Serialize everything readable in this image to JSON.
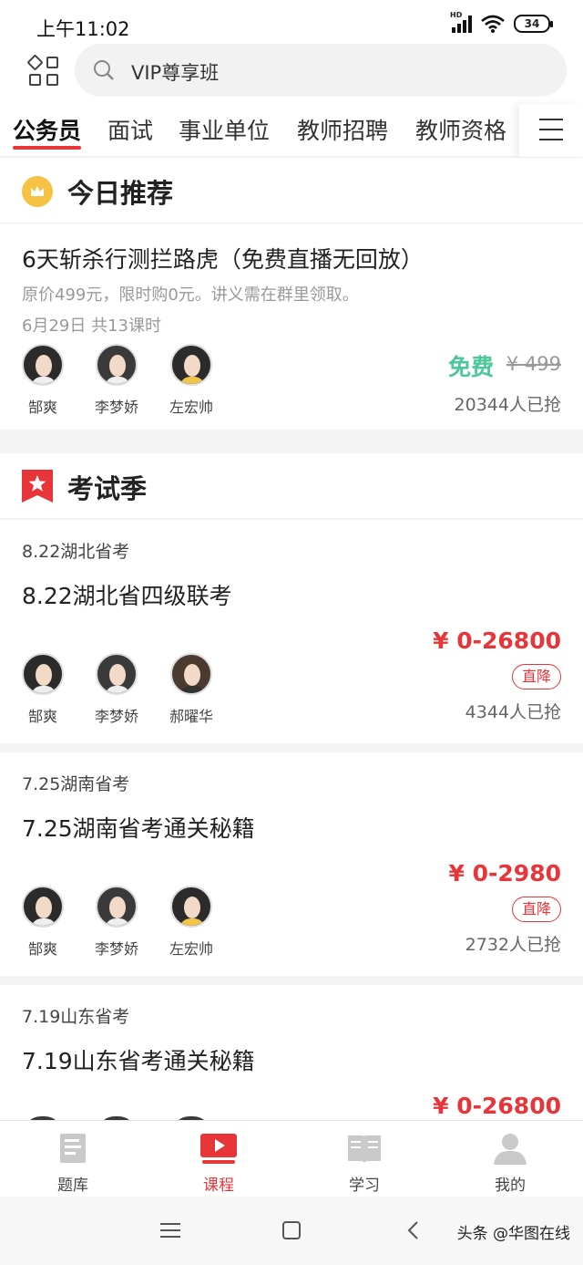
{
  "status": {
    "time": "上午11:02",
    "battery": "34",
    "network": "HD"
  },
  "search": {
    "placeholder": "VIP尊享班"
  },
  "tabs": [
    "公务员",
    "面试",
    "事业单位",
    "教师招聘",
    "教师资格"
  ],
  "today": {
    "heading": "今日推荐",
    "title": "6天斩杀行测拦路虎（免费直播无回放）",
    "desc": "原价499元，限时购0元。讲义需在群里领取。",
    "meta": "6月29日 共13课时",
    "teachers": [
      "郜爽",
      "李梦娇",
      "左宏帅"
    ],
    "price": "免费",
    "original_price": "¥ 499",
    "count": "20344人已抢"
  },
  "exam": {
    "heading": "考试季",
    "items": [
      {
        "sub": "8.22湖北省考",
        "title": "8.22湖北省四级联考",
        "price": "¥ 0-26800",
        "badge": "直降",
        "count": "4344人已抢",
        "teachers": [
          "郜爽",
          "李梦娇",
          "郝曜华"
        ]
      },
      {
        "sub": "7.25湖南省考",
        "title": "7.25湖南省考通关秘籍",
        "price": "¥ 0-2980",
        "badge": "直降",
        "count": "2732人已抢",
        "teachers": [
          "郜爽",
          "李梦娇",
          "左宏帅"
        ]
      },
      {
        "sub": "7.19山东省考",
        "title": "7.19山东省考通关秘籍",
        "price": "¥ 0-26800"
      }
    ]
  },
  "bottom_nav": [
    {
      "label": "题库",
      "icon": "question-bank-icon"
    },
    {
      "label": "课程",
      "icon": "course-play-icon"
    },
    {
      "label": "学习",
      "icon": "book-icon"
    },
    {
      "label": "我的",
      "icon": "profile-icon"
    }
  ],
  "watermark": "头条 @华图在线",
  "colors": {
    "accent": "#e8353a",
    "free": "#4cc79a",
    "crown": "#f6c243"
  }
}
